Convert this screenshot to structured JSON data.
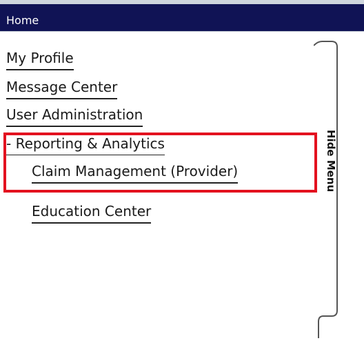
{
  "header": {
    "title": "Home"
  },
  "nav": {
    "items": [
      {
        "label": "My Profile"
      },
      {
        "label": "Message Center"
      },
      {
        "label": "User Administration"
      },
      {
        "label": "- Reporting & Analytics"
      },
      {
        "label": "Claim Management (Provider)"
      },
      {
        "label": "Education Center"
      }
    ]
  },
  "sidebar_toggle": {
    "label": "Hide Menu"
  },
  "colors": {
    "header_bg": "#101355",
    "highlight": "#e3111f"
  }
}
